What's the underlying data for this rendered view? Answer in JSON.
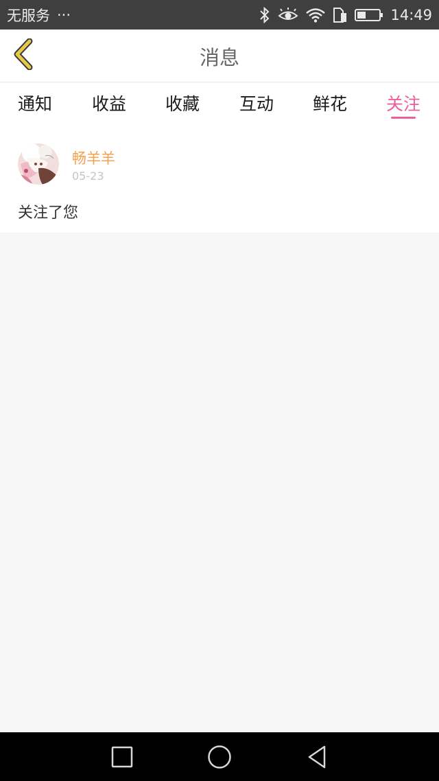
{
  "status_bar": {
    "carrier": "无服务",
    "more": "···",
    "time": "14:49",
    "icons": [
      "bluetooth-icon",
      "eye-icon",
      "wifi-icon",
      "sim-icon",
      "battery-icon"
    ]
  },
  "header": {
    "title": "消息",
    "back_icon": "chevron-left-icon",
    "back_color": "#e6c84a"
  },
  "tabs": {
    "items": [
      {
        "label": "通知",
        "active": false
      },
      {
        "label": "收益",
        "active": false
      },
      {
        "label": "收藏",
        "active": false
      },
      {
        "label": "互动",
        "active": false
      },
      {
        "label": "鲜花",
        "active": false
      },
      {
        "label": "关注",
        "active": true
      }
    ],
    "active_color": "#ea5f9e"
  },
  "messages": [
    {
      "username": "畅羊羊",
      "date": "05-23",
      "text": "关注了您"
    }
  ],
  "nav_bar": {
    "icons": [
      "square-icon",
      "circle-icon",
      "triangle-back-icon"
    ]
  }
}
